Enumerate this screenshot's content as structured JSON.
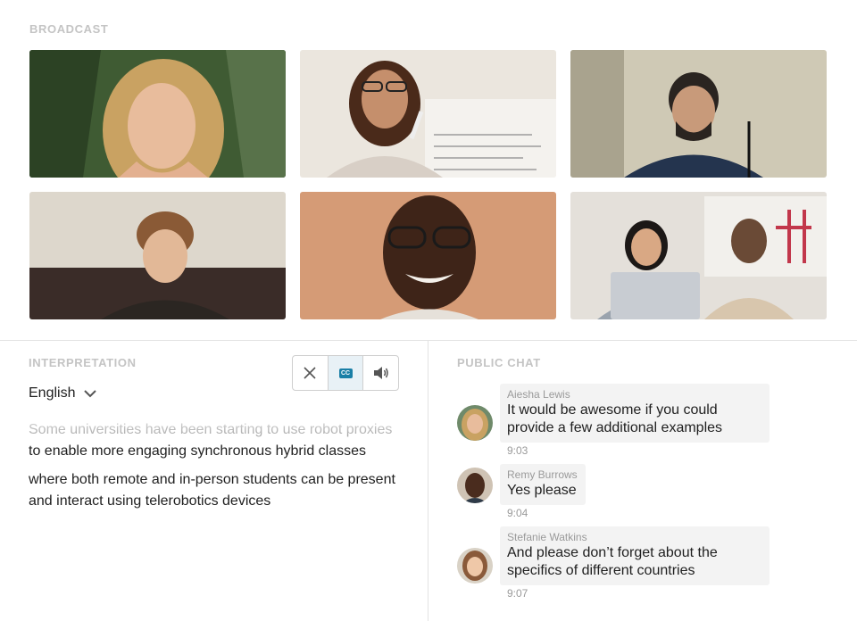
{
  "broadcast": {
    "label": "BROADCAST",
    "participants": [
      {
        "name": "participant-1",
        "bg": "#4a6a3a"
      },
      {
        "name": "participant-2",
        "bg": "#e9e3da"
      },
      {
        "name": "participant-3",
        "bg": "#c9c4b2"
      },
      {
        "name": "participant-4",
        "bg": "#dcd6cc"
      },
      {
        "name": "participant-5",
        "bg": "#d49a74"
      },
      {
        "name": "participant-6",
        "bg": "#d8d2cb"
      }
    ]
  },
  "interpretation": {
    "label": "INTERPRETATION",
    "language": "English",
    "controls": [
      {
        "name": "close-icon",
        "label": "close"
      },
      {
        "name": "cc-icon",
        "label": "CC",
        "active": true
      },
      {
        "name": "volume-icon",
        "label": "volume"
      }
    ],
    "transcript": [
      {
        "faded": "Some universities have been starting to use robot proxies",
        "line2": "to enable more engaging synchronous hybrid classes"
      },
      {
        "line1": "where both remote and in-person students can be present",
        "line2": "and interact using telerobotics devices"
      }
    ]
  },
  "chat": {
    "label": "PUBLIC CHAT",
    "messages": [
      {
        "sender": "Aiesha Lewis",
        "line1": "It would be awesome if you could",
        "line2": "provide a few additional examples",
        "time": "9:03"
      },
      {
        "sender": "Remy Burrows",
        "line1": "Yes please",
        "line2": "",
        "time": "9:04"
      },
      {
        "sender": "Stefanie Watkins",
        "line1": "And please don’t forget about the",
        "line2": "specifics of different countries",
        "time": "9:07"
      }
    ]
  },
  "colors": {
    "accent": "#1a7fa6",
    "label_gray": "#c4c4c4",
    "bubble_bg": "#f3f3f3"
  }
}
